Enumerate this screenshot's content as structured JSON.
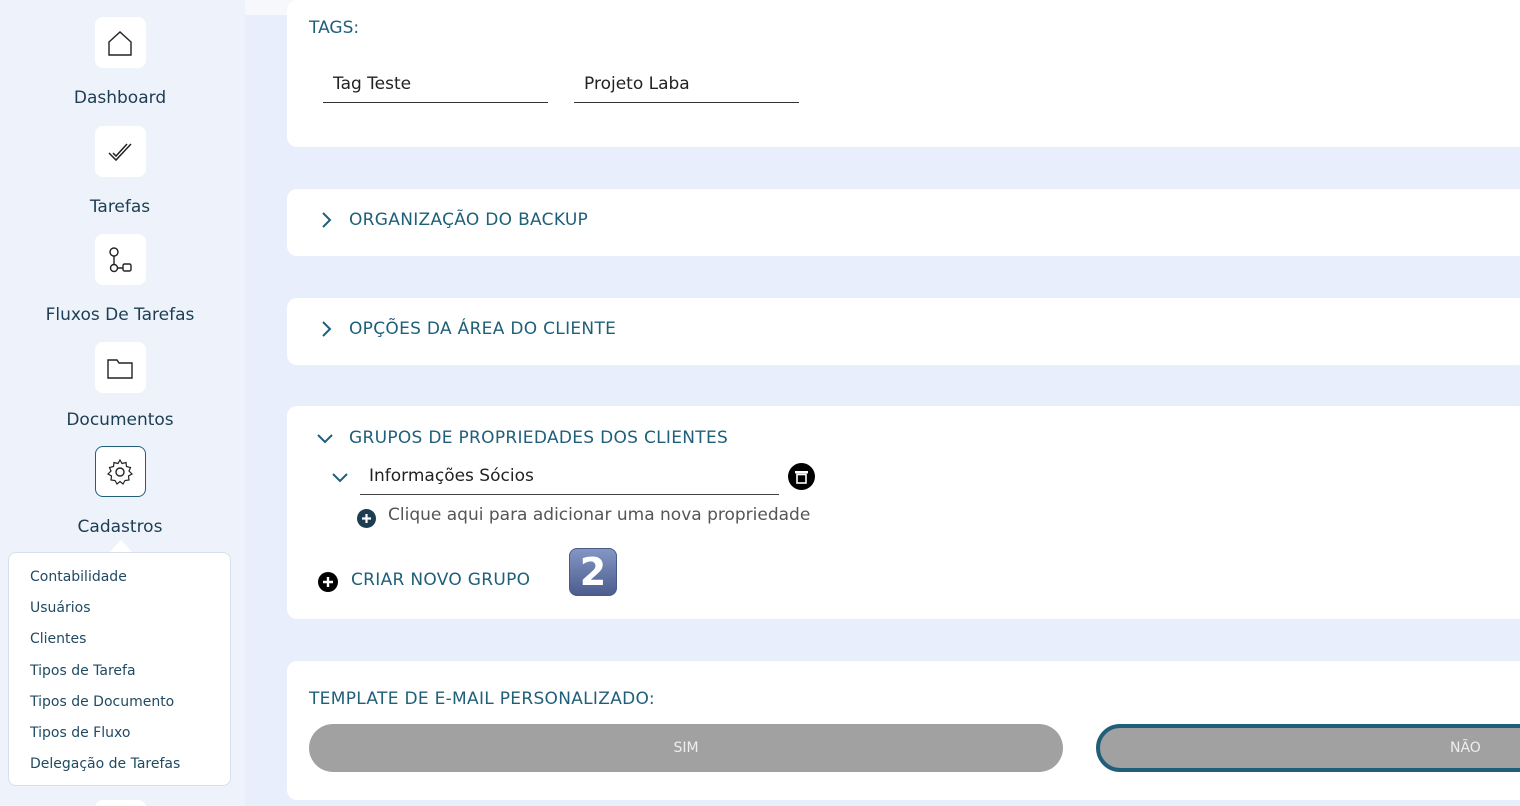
{
  "sidebar": {
    "nav": [
      {
        "label": "Dashboard",
        "icon": "home-icon"
      },
      {
        "label": "Tarefas",
        "icon": "checkmark-icon"
      },
      {
        "label": "Fluxos De Tarefas",
        "icon": "workflow-icon"
      },
      {
        "label": "Documentos",
        "icon": "folder-icon"
      },
      {
        "label": "Cadastros",
        "icon": "gear-icon",
        "active": true
      }
    ],
    "submenu": [
      "Contabilidade",
      "Usuários",
      "Clientes",
      "Tipos de Tarefa",
      "Tipos de Documento",
      "Tipos de Fluxo",
      "Delegação de Tarefas"
    ]
  },
  "tags": {
    "label": "TAGS:",
    "values": [
      "Tag Teste",
      "Projeto Laba"
    ]
  },
  "sections": {
    "backup": "ORGANIZAÇÃO DO BACKUP",
    "client_area": "OPÇÕES DA ÁREA DO CLIENTE",
    "property_groups": {
      "title": "GRUPOS DE PROPRIEDADES DOS CLIENTES",
      "group_name": "Informações Sócios",
      "add_property": "Clique aqui para adicionar uma nova propriedade",
      "create_group": "CRIAR NOVO GRUPO",
      "badge": "2"
    },
    "email_template": {
      "label": "TEMPLATE DE E-MAIL PERSONALIZADO:",
      "yes": "SIM",
      "no": "NÃO",
      "selected": "NÃO"
    }
  },
  "colors": {
    "accent": "#1f5f7a",
    "background": "#e9eefc",
    "sidebar": "#eef3fb",
    "toggle": "#a1a1a1"
  }
}
